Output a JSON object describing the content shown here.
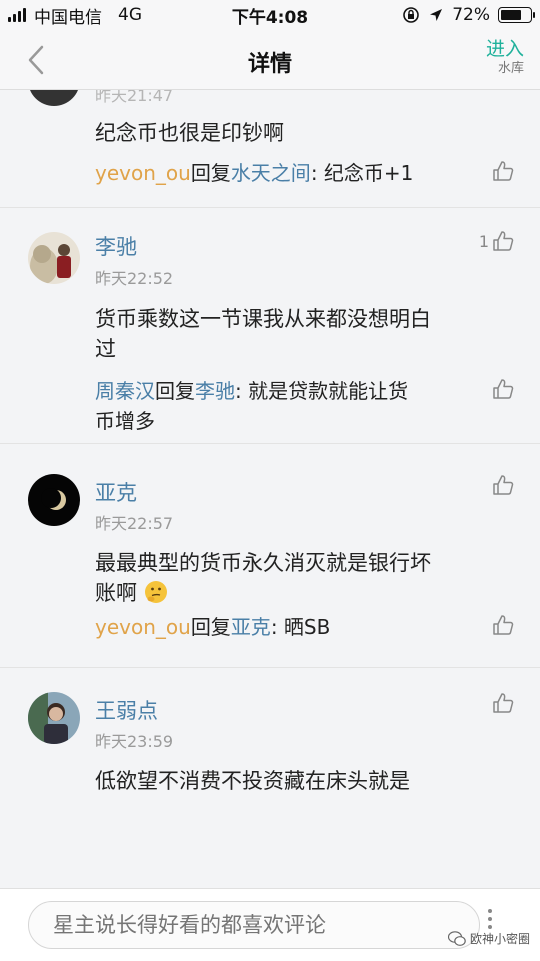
{
  "status_bar": {
    "carrier": "中国电信",
    "network": "4G",
    "time": "下午4:08",
    "battery": "72%",
    "battery_level": 0.72
  },
  "nav": {
    "title": "详情",
    "enter_label": "进入",
    "enter_sub": "水库"
  },
  "comments": [
    {
      "time": "昨天21:47",
      "text": "纪念币也很是印钞啊",
      "reply": {
        "from": "yevon_ou",
        "verb": "回复",
        "to": "水天之间",
        "body": ": 纪念币+1"
      }
    },
    {
      "author": "李驰",
      "time": "昨天22:52",
      "likes": "1",
      "text_lines": [
        "货币乘数这一节课我从来都没想明白",
        "过"
      ],
      "reply": {
        "from": "周秦汉",
        "verb": "回复",
        "to": "李驰",
        "body_lines": [
          ": 就是贷款就能让货",
          "币增多"
        ]
      }
    },
    {
      "author": "亚克",
      "time": "昨天22:57",
      "text_lines": [
        "最最典型的货币永久消灭就是银行坏",
        "账啊"
      ],
      "reply": {
        "from": "yevon_ou",
        "verb": "回复",
        "to": "亚克",
        "body": ": 晒SB"
      }
    },
    {
      "author": "王弱点",
      "time": "昨天23:59",
      "text": "低欲望不消费不投资藏在床头就是"
    }
  ],
  "bottom_bar": {
    "input_placeholder": "星主说长得好看的都喜欢评论",
    "watermark_logo": "欧神小密圈"
  },
  "colors": {
    "accent": "#1fb19b",
    "author": "#4a7fa7",
    "reply_name": "#e0a349"
  }
}
